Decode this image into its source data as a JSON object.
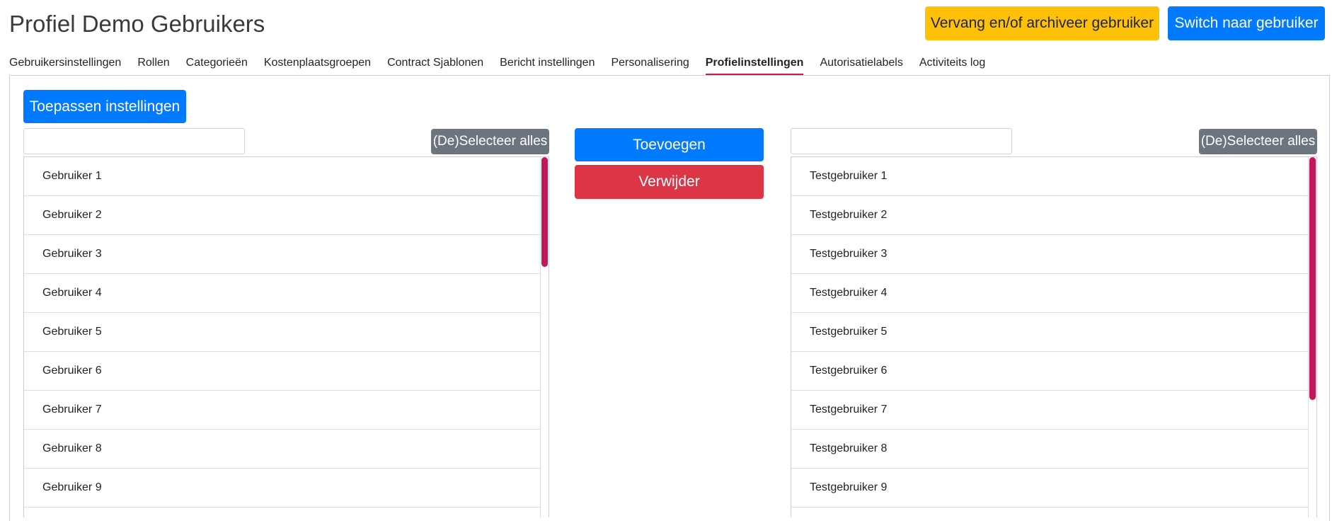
{
  "header": {
    "title": "Profiel Demo Gebruikers",
    "replace_button": "Vervang en/of archiveer gebruiker",
    "switch_button": "Switch naar gebruiker"
  },
  "tabs": [
    {
      "label": "Gebruikersinstellingen",
      "active": false
    },
    {
      "label": "Rollen",
      "active": false
    },
    {
      "label": "Categorieën",
      "active": false
    },
    {
      "label": "Kostenplaatsgroepen",
      "active": false
    },
    {
      "label": "Contract Sjablonen",
      "active": false
    },
    {
      "label": "Bericht instellingen",
      "active": false
    },
    {
      "label": "Personalisering",
      "active": false
    },
    {
      "label": "Profielinstellingen",
      "active": true
    },
    {
      "label": "Autorisatielabels",
      "active": false
    },
    {
      "label": "Activiteits log",
      "active": false
    }
  ],
  "main": {
    "apply_button": "Toepassen instellingen",
    "add_button": "Toevoegen",
    "remove_button": "Verwijder",
    "left_list": {
      "filter_value": "",
      "select_all_button": "(De)Selecteer alles",
      "items": [
        "Gebruiker 1",
        "Gebruiker 2",
        "Gebruiker 3",
        "Gebruiker 4",
        "Gebruiker 5",
        "Gebruiker 6",
        "Gebruiker 7",
        "Gebruiker 8",
        "Gebruiker 9"
      ]
    },
    "right_list": {
      "filter_value": "",
      "select_all_button": "(De)Selecteer alles",
      "items": [
        "Testgebruiker 1",
        "Testgebruiker 2",
        "Testgebruiker 3",
        "Testgebruiker 4",
        "Testgebruiker 5",
        "Testgebruiker 6",
        "Testgebruiker 7",
        "Testgebruiker 8",
        "Testgebruiker 9"
      ]
    }
  },
  "colors": {
    "primary": "#007bff",
    "warning": "#ffc107",
    "danger": "#dc3545",
    "secondary": "#6c757d",
    "accent": "#c2185b"
  }
}
